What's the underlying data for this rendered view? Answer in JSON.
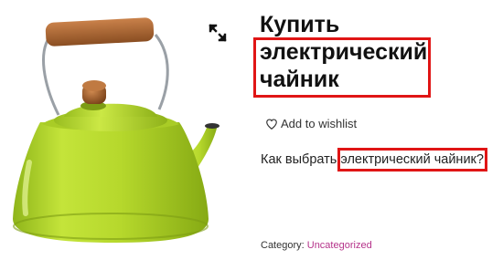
{
  "product": {
    "title_line1": "Купить",
    "title_line2": "электрический",
    "title_line3": "чайник",
    "image_name": "green-kettle",
    "zoom_icon": "expand-icon"
  },
  "wishlist": {
    "label": "Add to wishlist",
    "icon": "heart-icon"
  },
  "description": {
    "prefix": "Как выбрать ",
    "highlighted": "электрический чайник?"
  },
  "meta": {
    "category_label": "Category: ",
    "category_value": "Uncategorized"
  },
  "colors": {
    "highlight_border": "#e01515",
    "kettle_body": "#b5d92a",
    "category_link": "#b5338a"
  }
}
